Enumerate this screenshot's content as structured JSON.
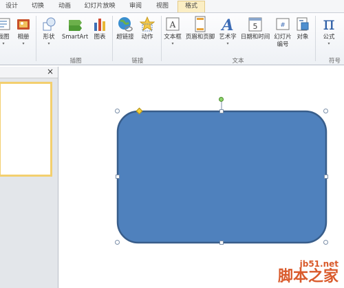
{
  "tabs": [
    {
      "label": "设计"
    },
    {
      "label": "切换"
    },
    {
      "label": "动画"
    },
    {
      "label": "幻灯片放映"
    },
    {
      "label": "审阅"
    },
    {
      "label": "视图"
    },
    {
      "label": "格式"
    }
  ],
  "ribbon": {
    "buttons": {
      "screenshot": "截图",
      "album": "相册",
      "shape": "形状",
      "smartart": "SmartArt",
      "chart": "图表",
      "hyperlink": "超链接",
      "action": "动作",
      "textbox": "文本框",
      "header_footer": "页眉和页脚",
      "wordart": "艺术字",
      "datetime": "日期和时间",
      "slide_number_l1": "幻灯片",
      "slide_number_l2": "编号",
      "object": "对象",
      "equation": "公式",
      "pi_symbol": "π"
    },
    "groups": {
      "illustrations": "插图",
      "links": "链接",
      "text": "文本",
      "symbols": "符号"
    }
  },
  "left_panel": {
    "close_symbol": "×"
  },
  "watermark": {
    "site": "jb51.net",
    "name": "脚本之家"
  },
  "colors": {
    "shape_fill": "#4f81bd",
    "shape_border": "#385d8a",
    "active_tab": "#fbeec4",
    "thumb_border": "#f3cf6e",
    "watermark": "#d95a2b"
  }
}
